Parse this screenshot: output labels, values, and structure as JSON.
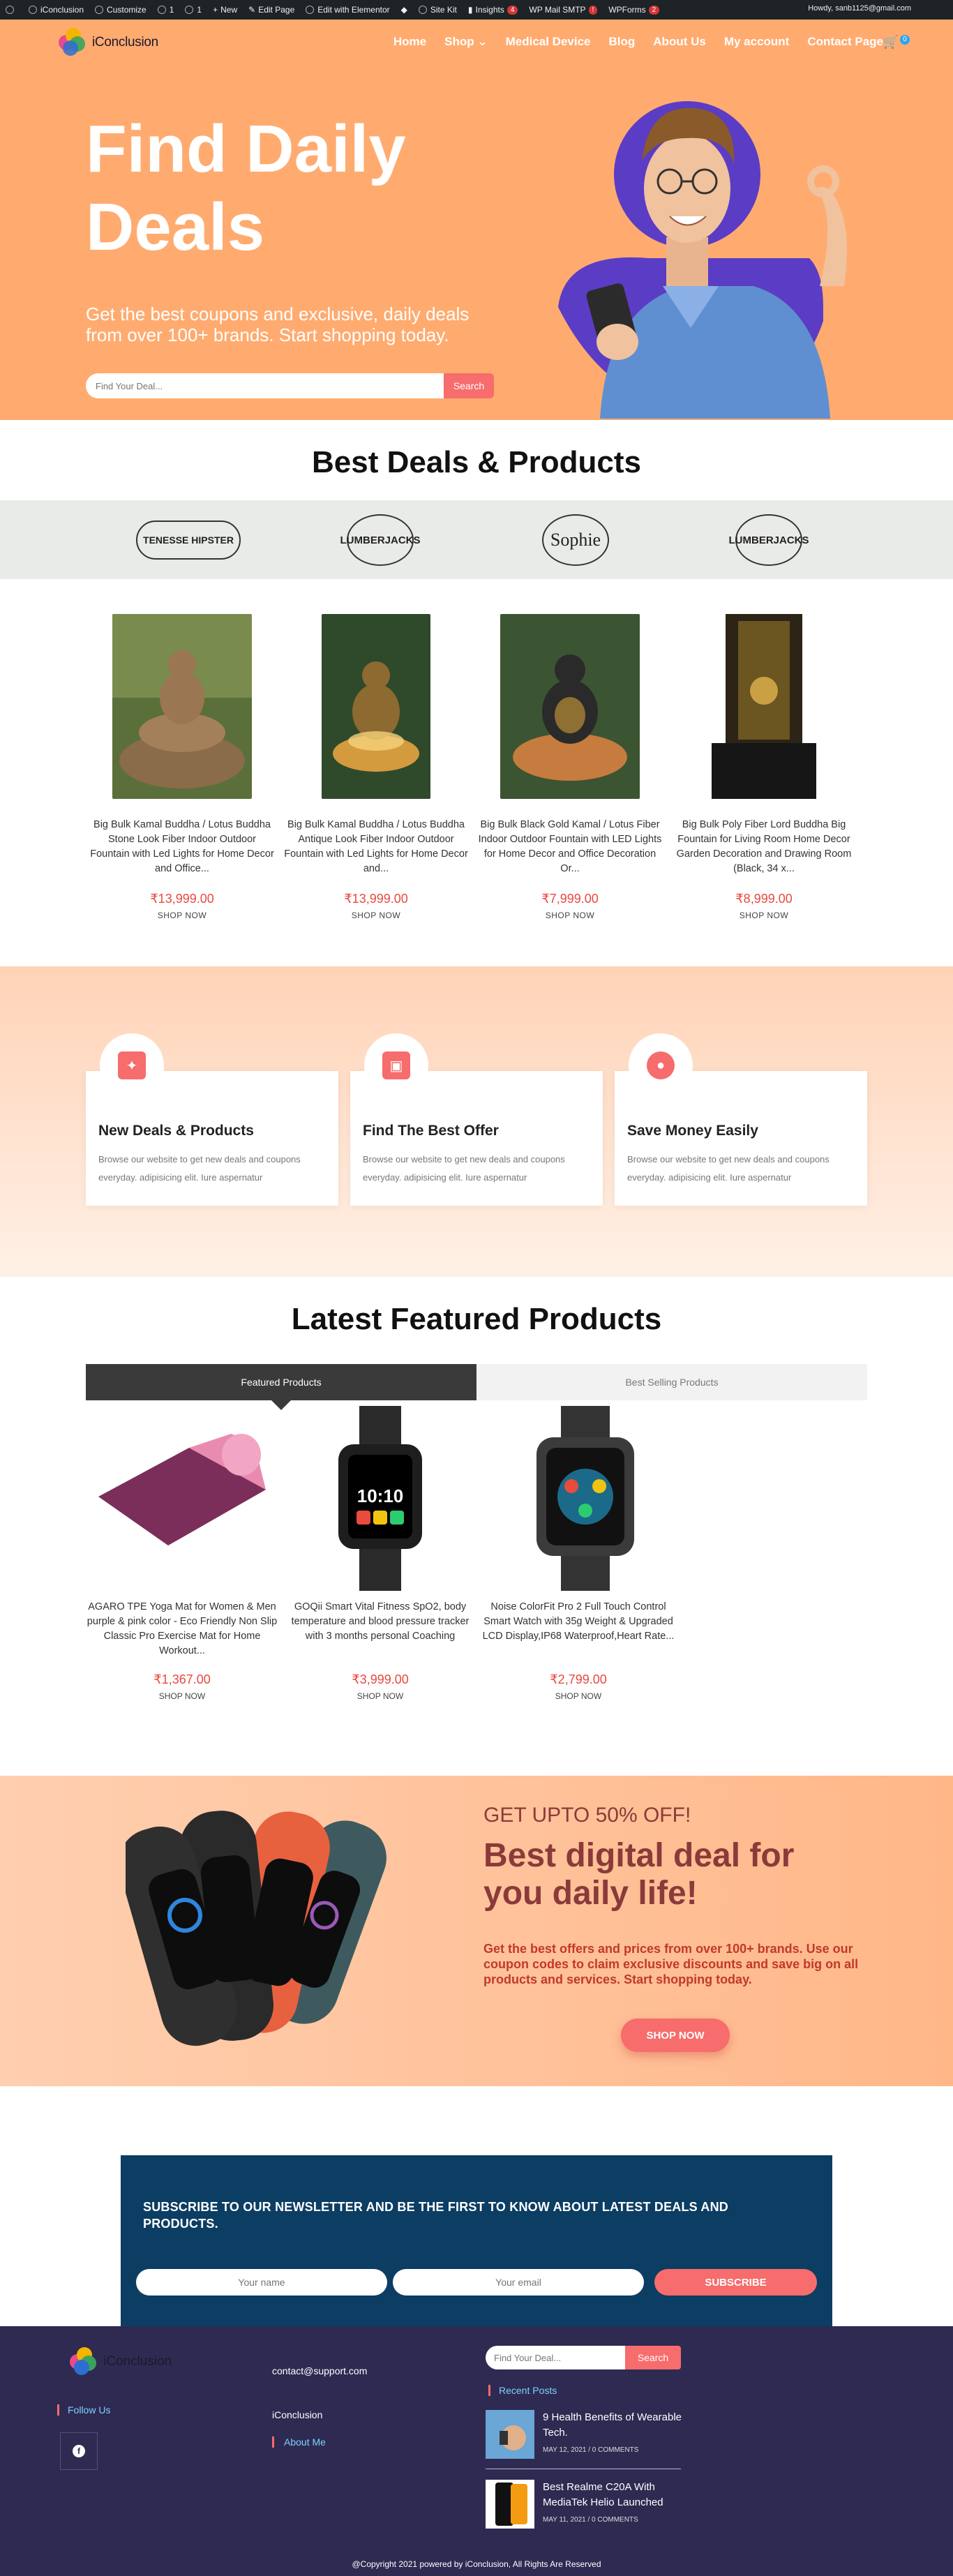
{
  "adminbar": {
    "items": [
      "iConclusion",
      "Customize",
      "1",
      "1",
      "New",
      "Edit Page",
      "Edit with Elementor",
      "Site Kit",
      "Insights",
      "WP Mail SMTP",
      "WPForms"
    ],
    "insights_count": "4",
    "smtp_count": "!",
    "wpforms_count": "2",
    "howdy": "Howdy, sanb1125@gmail.com"
  },
  "header": {
    "logo_text": "iConclusion",
    "nav": [
      "Home",
      "Shop",
      "Medical Device",
      "Blog",
      "About Us",
      "My account",
      "Contact Page"
    ],
    "shop_caret": "⌄",
    "cart_count": "0"
  },
  "hero": {
    "title": "Find Daily Deals",
    "subtitle": "Get the best coupons and exclusive, daily deals from over 100+ brands. Start shopping today.",
    "search_placeholder": "Find Your Deal...",
    "search_button": "Search"
  },
  "best_deals": {
    "title": "Best Deals & Products",
    "brands": [
      "TENESSE HIPSTER",
      "LUMBERJACKS",
      "Sophie",
      "LUMBERJACKS"
    ],
    "products": [
      {
        "title": "Big Bulk Kamal Buddha / Lotus Buddha Stone Look Fiber Indoor Outdoor Fountain with Led Lights for Home Decor and Office...",
        "price": "₹13,999.00",
        "shop": "SHOP NOW"
      },
      {
        "title": "Big Bulk Kamal Buddha / Lotus Buddha Antique Look Fiber Indoor Outdoor Fountain with Led Lights for Home Decor and...",
        "price": "₹13,999.00",
        "shop": "SHOP NOW"
      },
      {
        "title": "Big Bulk Black Gold Kamal / Lotus Fiber Indoor Outdoor Fountain with LED Lights for Home Decor and Office Decoration Or...",
        "price": "₹7,999.00",
        "shop": "SHOP NOW"
      },
      {
        "title": "Big Bulk Poly Fiber Lord Buddha Big Fountain for Living Room Home Decor Garden Decoration and Drawing Room (Black, 34 x...",
        "price": "₹8,999.00",
        "shop": "SHOP NOW"
      }
    ]
  },
  "features": [
    {
      "title": "New Deals & Products",
      "text": "Browse our website to get new deals and coupons everyday. adipisicing elit. Iure aspernatur",
      "icon": "handshake-icon"
    },
    {
      "title": "Find The Best Offer",
      "text": "Browse our website to get new deals and coupons everyday. adipisicing elit. Iure aspernatur",
      "icon": "gift-icon"
    },
    {
      "title": "Save Money Easily",
      "text": "Browse our website to get new deals and coupons everyday. adipisicing elit. Iure aspernatur",
      "icon": "piggy-bank-icon"
    }
  ],
  "featured": {
    "title": "Latest Featured Products",
    "tabs": [
      "Featured Products",
      "Best Selling Products"
    ],
    "products": [
      {
        "title": "AGARO TPE Yoga Mat for Women & Men purple & pink color - Eco Friendly Non Slip Classic Pro Exercise Mat for Home Workout...",
        "price": "₹1,367.00",
        "shop": "SHOP NOW"
      },
      {
        "title": "GOQii Smart Vital Fitness SpO2, body temperature and blood pressure tracker with 3 months personal Coaching",
        "price": "₹3,999.00",
        "shop": "SHOP NOW"
      },
      {
        "title": "Noise ColorFit Pro 2 Full Touch Control Smart Watch with 35g Weight & Upgraded LCD Display,IP68 Waterproof,Heart Rate...",
        "price": "₹2,799.00",
        "shop": "SHOP NOW"
      }
    ],
    "watch_time": "10:10"
  },
  "promo": {
    "kicker": "GET UPTO 50% OFF!",
    "title": "Best digital deal for you daily life!",
    "text": "Get the best offers and prices from over 100+ brands. Use our coupon codes to claim exclusive discounts and save big on all products and services. Start shopping today.",
    "button": "SHOP NOW"
  },
  "newsletter": {
    "title": "SUBSCRIBE TO OUR NEWSLETTER AND BE THE FIRST TO KNOW ABOUT LATEST DEALS AND PRODUCTS.",
    "name_placeholder": "Your name",
    "email_placeholder": "Your email",
    "button": "SUBSCRIBE"
  },
  "footer": {
    "logo_text": "iConclusion",
    "follow": "Follow Us",
    "email": "contact@support.com",
    "brand": "iConclusion",
    "about": "About Me",
    "search_placeholder": "Find Your Deal...",
    "search_button": "Search",
    "recent_title": "Recent Posts",
    "posts": [
      {
        "title": "9 Health Benefits of Wearable Tech.",
        "meta": "MAY 12, 2021 / 0 COMMENTS"
      },
      {
        "title": "Best Realme C20A With MediaTek Helio Launched",
        "meta": "MAY 11, 2021 / 0 COMMENTS"
      }
    ],
    "copyright": "@Copyright 2021 powered by iConclusion, All Rights Are Reserved"
  },
  "colors": {
    "accent": "#ffab70",
    "coral": "#f76c6c",
    "price": "#e8493f",
    "footer": "#2e2a52",
    "newsletter": "#0c3d63"
  }
}
